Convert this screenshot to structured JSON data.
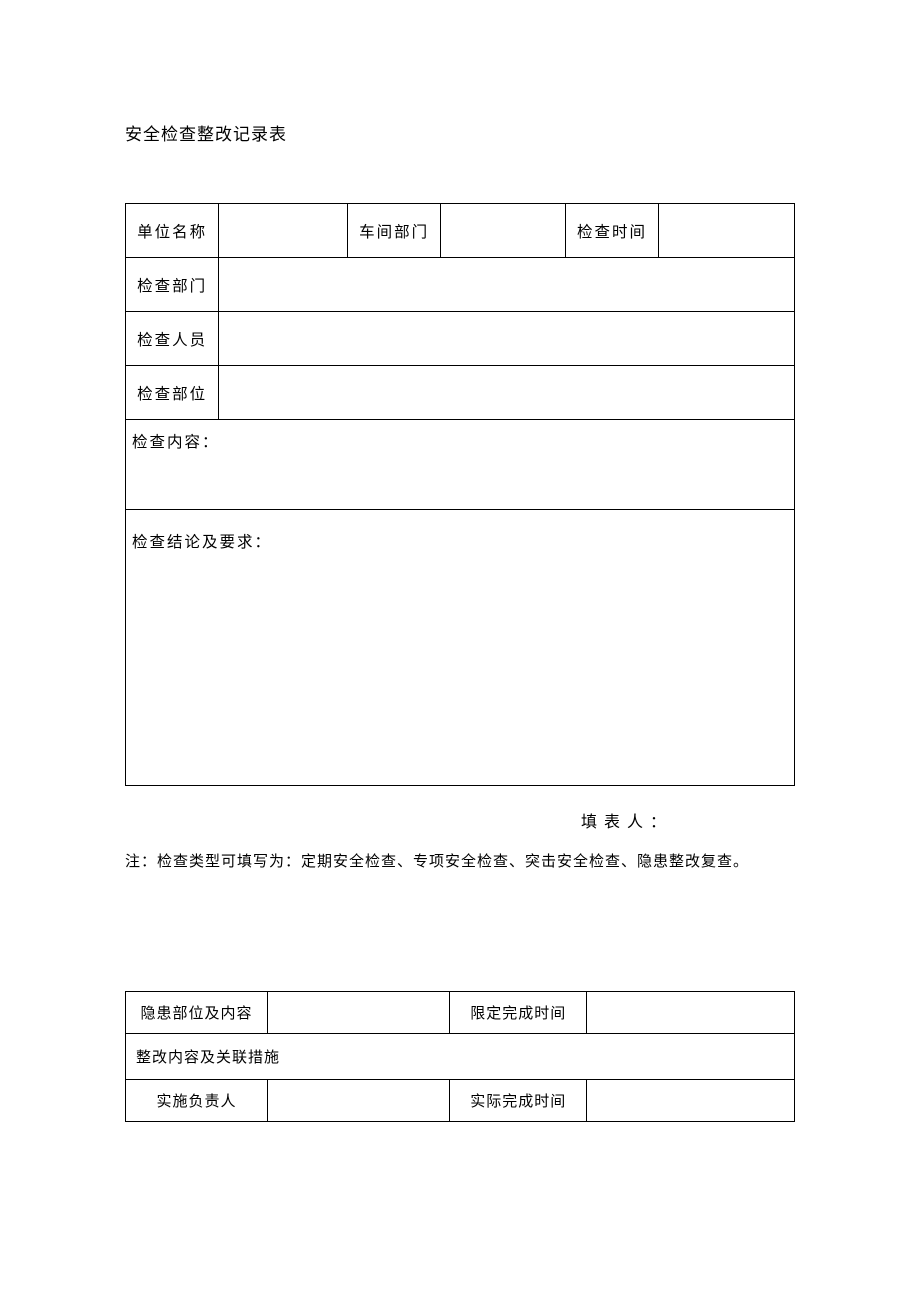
{
  "title": "安全检查整改记录表",
  "table1": {
    "row1": {
      "label1": "单位名称",
      "value1": "",
      "label2": "车间部门",
      "value2": "",
      "label3": "检查时间",
      "value3": ""
    },
    "row2": {
      "label": "检查部门",
      "value": ""
    },
    "row3": {
      "label": "检查人员",
      "value": ""
    },
    "row4": {
      "label": "检查部位",
      "value": ""
    },
    "row5": {
      "label": "检查内容："
    },
    "row6": {
      "label": "检查结论及要求："
    }
  },
  "filler": "填表人：",
  "note": "注：检查类型可填写为：定期安全检查、专项安全检查、突击安全检查、隐患整改复查。",
  "table2": {
    "row1": {
      "label1": "隐患部位及内容",
      "value1": "",
      "label2": "限定完成时间",
      "value2": ""
    },
    "row2": {
      "label": "整改内容及关联措施"
    },
    "row3": {
      "label1": "实施负责人",
      "value1": "",
      "label2": "实际完成时间",
      "value2": ""
    }
  }
}
